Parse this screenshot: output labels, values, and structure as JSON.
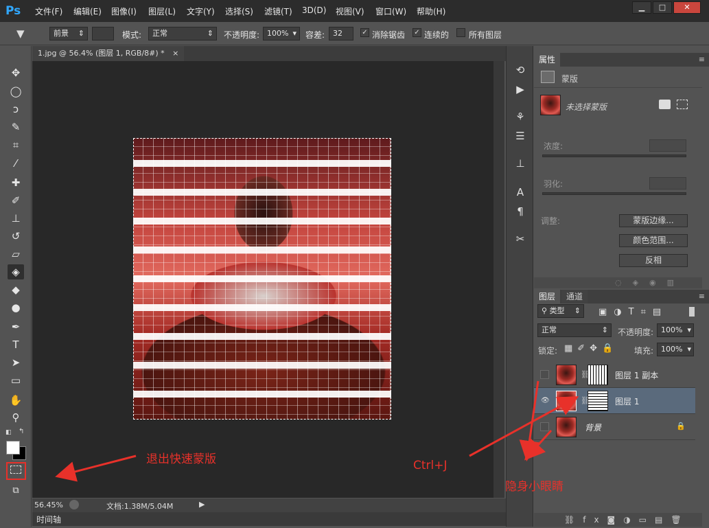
{
  "app": {
    "logo": "Ps",
    "logo_color": "#31a8ff"
  },
  "menu": [
    "文件(F)",
    "编辑(E)",
    "图像(I)",
    "图层(L)",
    "文字(Y)",
    "选择(S)",
    "滤镜(T)",
    "3D(D)",
    "视图(V)",
    "窗口(W)",
    "帮助(H)"
  ],
  "window_controls": {
    "minimize": "▁",
    "maximize": "□",
    "close": "✕"
  },
  "options": {
    "fill_source": "前景",
    "mode_label": "模式:",
    "mode_value": "正常",
    "opacity_label": "不透明度:",
    "opacity_value": "100%",
    "tolerance_label": "容差:",
    "tolerance_value": "32",
    "antialias_label": "消除锯齿",
    "contiguous_label": "连续的",
    "all_layers_label": "所有图层"
  },
  "document": {
    "tab_title": "1.jpg @ 56.4% (图层 1, RGB/8#) *",
    "tab_close": "×",
    "zoom": "56.45%",
    "doc_info": "文档:1.38M/5.04M",
    "timeline_label": "时间轴"
  },
  "properties": {
    "tab_label": "属性",
    "mask_header": "蒙版",
    "mask_status": "未选择蒙版",
    "density_label": "浓度:",
    "feather_label": "羽化:",
    "adjust_label": "调整:",
    "mask_edge_button": "蒙版边缘...",
    "color_range_button": "颜色范围...",
    "invert_button": "反相"
  },
  "layers_panel": {
    "tabs": [
      "图层",
      "通道"
    ],
    "filter_kind": "类型",
    "blend_mode": "正常",
    "opacity_label": "不透明度:",
    "opacity_value": "100%",
    "lock_label": "锁定:",
    "fill_label": "填充:",
    "fill_value": "100%",
    "layers": [
      {
        "name": "图层 1 副本",
        "visible": false,
        "selected": false,
        "mask": "vertical"
      },
      {
        "name": "图层 1",
        "visible": true,
        "selected": true,
        "mask": "horizontal"
      },
      {
        "name": "背景",
        "visible": false,
        "selected": false,
        "locked": true
      }
    ]
  },
  "annotations": {
    "exit_quick_mask": "退出快速蒙版",
    "ctrl_j": "Ctrl+J",
    "hide_eye": "隐身小眼睛",
    "color": "#e8312a"
  }
}
